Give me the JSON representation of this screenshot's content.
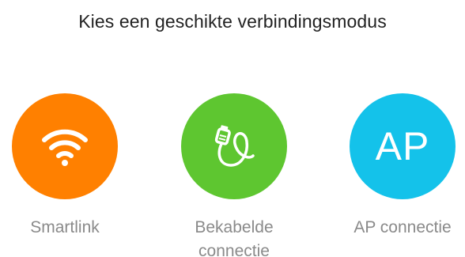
{
  "header": {
    "title": "Kies een geschikte verbindingsmodus"
  },
  "modes": [
    {
      "label": "Smartlink",
      "icon": "wifi-icon",
      "color": "#FF8000"
    },
    {
      "label_line1": "Bekabelde",
      "label_line2": "connectie",
      "icon": "cable-icon",
      "color": "#5EC630"
    },
    {
      "label": "AP connectie",
      "icon_text": "AP",
      "color": "#14C2EA"
    }
  ]
}
